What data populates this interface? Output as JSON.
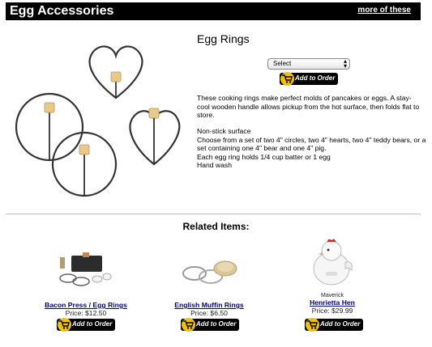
{
  "header": {
    "title": "Egg Accessories",
    "more_link": "more of these"
  },
  "product": {
    "title": "Egg Rings",
    "select_value": "Select",
    "add_to_order": "Add to Order",
    "description": "These cooking rings make perfect molds of pancakes or eggs. A stay-cool wooden handle allows pickup from the hot surface, then folds flat to store.",
    "features": [
      "Non-stick surface",
      "Choose from a set of two 4\" circles, two 4\" hearts, two 4\" teddy bears, or a set containing one 4\" bear and one 4\" pig.",
      "Each egg ring holds 1/4 cup batter or 1 egg",
      "Hand wash"
    ]
  },
  "related": {
    "title": "Related Items:",
    "items": [
      {
        "name": "Bacon Press / Egg Rings",
        "price": "Price: $12.50",
        "button": "Add to Order"
      },
      {
        "name": "English Muffin Rings",
        "price": "Price: $6.50",
        "button": "Add to Order"
      },
      {
        "brand": "Maverick",
        "name": "Henrietta Hen",
        "price": "Price: $29.99",
        "button": "Add to Order"
      }
    ]
  },
  "colors": {
    "header_bg": "#000000",
    "cart_yellow": "#f2c200",
    "link_blue": "#000080"
  },
  "icons": [
    "cart-icon",
    "select-arrows-icon"
  ]
}
